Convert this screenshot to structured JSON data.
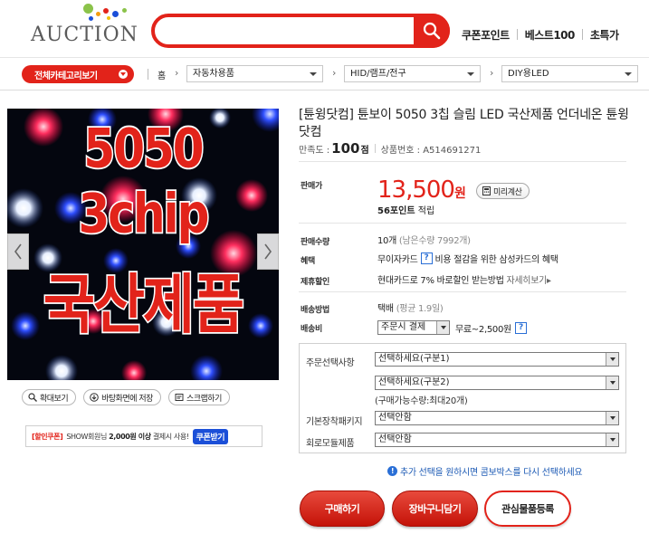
{
  "header": {
    "logo_text": "AUCTION",
    "search": {
      "value": "",
      "placeholder": ""
    },
    "links": [
      "쿠폰포인트",
      "베스트100",
      "초특가"
    ]
  },
  "categories": {
    "all_label": "전체카테고리보기",
    "home": "홈",
    "level1": "자동차용품",
    "level2": "HID/램프/전구",
    "level3": "DIY용LED"
  },
  "image": {
    "line1": "5050 3chip",
    "line2": "국산제품"
  },
  "image_buttons": {
    "zoom": "확대보기",
    "wallpaper": "바탕화면에 저장",
    "scrap": "스크랩하기"
  },
  "coupon": {
    "tag": "[할인쿠폰]",
    "message_prefix": "SHOW회원님",
    "message_amount": "2,000원 이상",
    "message_suffix": "결제시 사용!",
    "button": "쿠폰받기"
  },
  "product": {
    "title": "[튠윙닷컴] 튠보이 5050 3칩 슬림 LED 국산제품 언더네온 튠윙닷컴",
    "satisfaction_label": "만족도 :",
    "satisfaction_score": "100",
    "satisfaction_unit": "점",
    "product_no": "상품번호 : A514691271"
  },
  "price": {
    "label": "판매가",
    "amount": "13,500",
    "unit": "원",
    "calc_button": "미리계산",
    "points_value": "56포인트",
    "points_suffix": "적립"
  },
  "details": {
    "qty_label": "판매수량",
    "qty_value": "10개",
    "qty_remaining": "(남은수량 7992개)",
    "benefit_label": "혜택",
    "benefit_value": "무이자카드",
    "benefit_desc": "비용 절감을 위한 삼성카드의 혜택",
    "partner_label": "제휴할인",
    "partner_value": "현대카드로 7% 바로할인 받는방법",
    "partner_link": "자세히보기",
    "ship_method_label": "배송방법",
    "ship_method_value": "택배",
    "ship_method_avg": "(평균 1.9일)",
    "ship_fee_label": "배송비",
    "ship_fee_select": "주문시 결제",
    "ship_fee_value": "무료~2,500원"
  },
  "options": {
    "order_label": "주문선택사항",
    "order_select_1": "선택하세요(구분1)",
    "order_select_2": "선택하세요(구분2)",
    "order_note": "(구매가능수량:최대20개)",
    "basic_label": "기본장착패키지",
    "basic_select": "선택안함",
    "circuit_label": "회로모듈제품",
    "circuit_select": "선택안함",
    "additional_msg": "추가 선택을 원하시면 콤보박스를 다시 선택하세요"
  },
  "actions": {
    "buy": "구매하기",
    "cart": "장바구니담기",
    "wish": "관심물품등록"
  },
  "colors": {
    "brand_red": "#e2231a",
    "price_red": "#e2231a",
    "link_blue": "#1e5bb5",
    "coupon_blue": "#1b4fd8"
  },
  "icons": {
    "search": "search-icon",
    "chevron": "chevron-down-icon",
    "prev": "chevron-left-icon",
    "next": "chevron-right-icon",
    "calculator": "calculator-icon",
    "help": "help-icon",
    "info": "info-icon"
  }
}
